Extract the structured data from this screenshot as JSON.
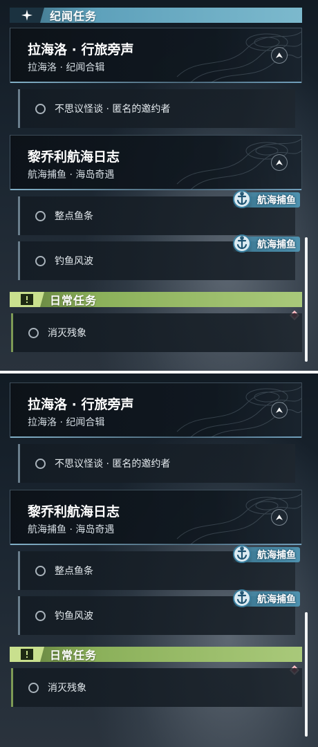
{
  "top": {
    "lore_header": {
      "title": "纪闻任务",
      "icon": "star-sparkle-icon"
    },
    "groups": [
      {
        "title": "拉海洛 · 行旅旁声",
        "subtitle": "拉海洛 · 纪闻合辑",
        "quests": [
          {
            "label": "不思议怪谈 · 匿名的邀约者"
          }
        ]
      },
      {
        "title": "黎乔利航海日志",
        "subtitle": "航海捕鱼 · 海岛奇遇",
        "quests": [
          {
            "label": "整点鱼条",
            "tag": "航海捕鱼"
          },
          {
            "label": "钓鱼风波",
            "tag": "航海捕鱼"
          }
        ]
      }
    ],
    "daily_header": {
      "title": "日常任务",
      "icon": "alert-box-icon"
    },
    "daily_quests": [
      {
        "label": "消灭残象"
      }
    ]
  },
  "bottom": {
    "groups": [
      {
        "title": "拉海洛 · 行旅旁声",
        "subtitle": "拉海洛 · 纪闻合辑",
        "quests": [
          {
            "label": "不思议怪谈 · 匿名的邀约者"
          }
        ]
      },
      {
        "title": "黎乔利航海日志",
        "subtitle": "航海捕鱼 · 海岛奇遇",
        "quests": [
          {
            "label": "整点鱼条",
            "tag": "航海捕鱼"
          },
          {
            "label": "钓鱼风波",
            "tag": "航海捕鱼"
          }
        ]
      }
    ],
    "daily_header": {
      "title": "日常任务",
      "icon": "alert-box-icon"
    },
    "daily_quests": [
      {
        "label": "消灭残象"
      }
    ]
  },
  "colors": {
    "lore_accent": "#5ea1bb",
    "daily_accent": "#8bb05a",
    "marker_red": "#d8485a",
    "tag_blue": "#4f96b4"
  }
}
